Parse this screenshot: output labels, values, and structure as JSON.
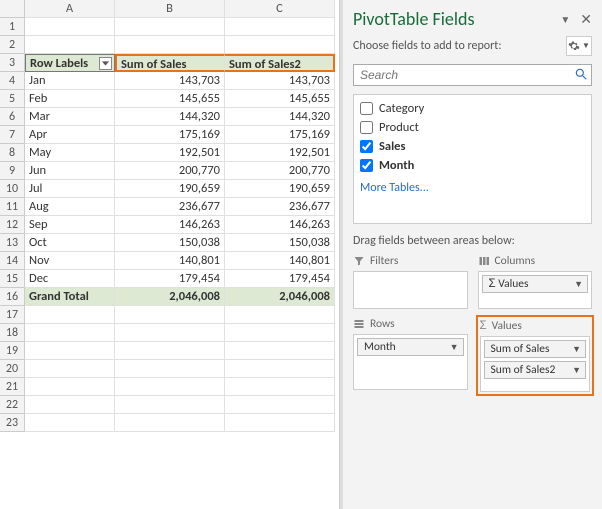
{
  "spreadsheet": {
    "columns": [
      "A",
      "B",
      "C"
    ],
    "row_numbers": [
      1,
      2,
      3,
      4,
      5,
      6,
      7,
      8,
      9,
      10,
      11,
      12,
      13,
      14,
      15,
      16,
      17,
      18,
      19,
      20,
      21,
      22,
      23
    ],
    "header": {
      "row_labels": "Row Labels",
      "col_b": "Sum of Sales",
      "col_c": "Sum of Sales2"
    },
    "rows": [
      {
        "label": "Jan",
        "b": "143,703",
        "c": "143,703"
      },
      {
        "label": "Feb",
        "b": "145,655",
        "c": "145,655"
      },
      {
        "label": "Mar",
        "b": "144,320",
        "c": "144,320"
      },
      {
        "label": "Apr",
        "b": "175,169",
        "c": "175,169"
      },
      {
        "label": "May",
        "b": "192,501",
        "c": "192,501"
      },
      {
        "label": "Jun",
        "b": "200,770",
        "c": "200,770"
      },
      {
        "label": "Jul",
        "b": "190,659",
        "c": "190,659"
      },
      {
        "label": "Aug",
        "b": "236,677",
        "c": "236,677"
      },
      {
        "label": "Sep",
        "b": "146,263",
        "c": "146,263"
      },
      {
        "label": "Oct",
        "b": "150,038",
        "c": "150,038"
      },
      {
        "label": "Nov",
        "b": "140,801",
        "c": "140,801"
      },
      {
        "label": "Dec",
        "b": "179,454",
        "c": "179,454"
      }
    ],
    "grand": {
      "label": "Grand Total",
      "b": "2,046,008",
      "c": "2,046,008"
    }
  },
  "sidebar": {
    "title": "PivotTable Fields",
    "subtitle": "Choose fields to add to report:",
    "search_placeholder": "Search",
    "fields": [
      {
        "label": "Category",
        "checked": false,
        "bold": false
      },
      {
        "label": "Product",
        "checked": false,
        "bold": false
      },
      {
        "label": "Sales",
        "checked": true,
        "bold": true
      },
      {
        "label": "Month",
        "checked": true,
        "bold": true
      }
    ],
    "more_tables": "More Tables...",
    "drag_label": "Drag fields between areas below:",
    "areas": {
      "filters_label": "Filters",
      "columns_label": "Columns",
      "rows_label": "Rows",
      "values_label": "Values",
      "columns_pill": "Values",
      "rows_pill": "Month",
      "values_pills": [
        "Sum of Sales",
        "Sum of Sales2"
      ]
    }
  }
}
